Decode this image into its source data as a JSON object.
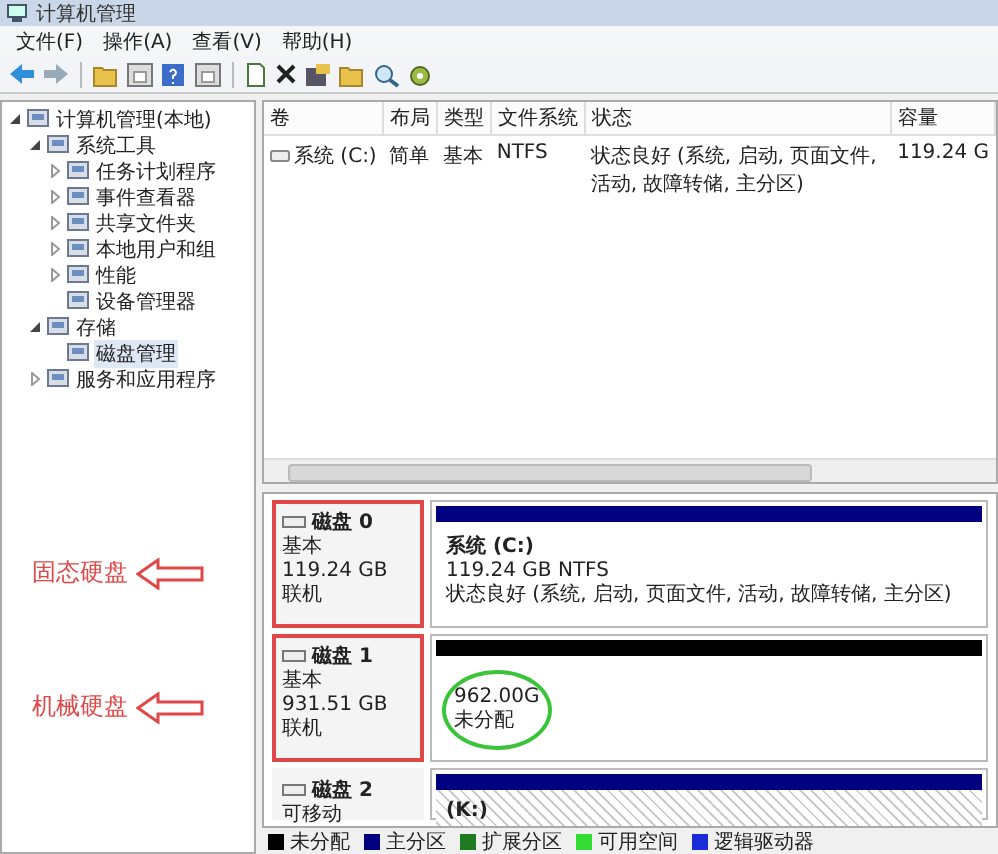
{
  "window": {
    "title": "计算机管理"
  },
  "menu": [
    "文件(F)",
    "操作(A)",
    "查看(V)",
    "帮助(H)"
  ],
  "tree": [
    {
      "label": "计算机管理(本地)",
      "expanded": true,
      "children": [
        {
          "label": "系统工具",
          "expanded": true,
          "children": [
            {
              "label": "任务计划程序",
              "expanded": false
            },
            {
              "label": "事件查看器",
              "expanded": false
            },
            {
              "label": "共享文件夹",
              "expanded": false
            },
            {
              "label": "本地用户和组",
              "expanded": false
            },
            {
              "label": "性能",
              "expanded": false
            },
            {
              "label": "设备管理器"
            }
          ]
        },
        {
          "label": "存储",
          "expanded": true,
          "children": [
            {
              "label": "磁盘管理",
              "selected": true
            }
          ]
        },
        {
          "label": "服务和应用程序",
          "expanded": false
        }
      ]
    }
  ],
  "table": {
    "columns": [
      "卷",
      "布局",
      "类型",
      "文件系统",
      "状态",
      "容量"
    ],
    "rows": [
      [
        "系统 (C:)",
        "简单",
        "基本",
        "NTFS",
        "状态良好 (系统, 启动, 页面文件, 活动, 故障转储, 主分区)",
        "119.24 G"
      ]
    ]
  },
  "disks": [
    {
      "name": "磁盘 0",
      "lines": [
        "基本",
        "119.24 GB",
        "联机"
      ],
      "highlighted": true,
      "partitions": [
        {
          "kind": "primary",
          "title": "系统 (C:)",
          "lines": [
            "119.24 GB NTFS",
            "状态良好 (系统, 启动, 页面文件, 活动, 故障转储, 主分区)"
          ],
          "circled": false
        }
      ]
    },
    {
      "name": "磁盘 1",
      "lines": [
        "基本",
        "931.51 GB",
        "联机"
      ],
      "highlighted": true,
      "partitions": [
        {
          "kind": "unallocated",
          "lines": [
            "962.00G",
            "未分配"
          ],
          "circled": true
        }
      ]
    },
    {
      "name": "磁盘 2",
      "lines": [
        "可移动"
      ],
      "highlighted": false,
      "partitions": [
        {
          "kind": "primary",
          "title": "(K:)",
          "circled": false
        }
      ]
    }
  ],
  "annotations": [
    {
      "label": "固态硬盘"
    },
    {
      "label": "机械硬盘"
    }
  ],
  "legend": [
    {
      "label": "未分配",
      "color": "#000000"
    },
    {
      "label": "主分区",
      "color": "#000080"
    },
    {
      "label": "扩展分区",
      "color": "#1e7a1e"
    },
    {
      "label": "可用空间",
      "color": "#33dd33"
    },
    {
      "label": "逻辑驱动器",
      "color": "#1a2bd8"
    }
  ]
}
